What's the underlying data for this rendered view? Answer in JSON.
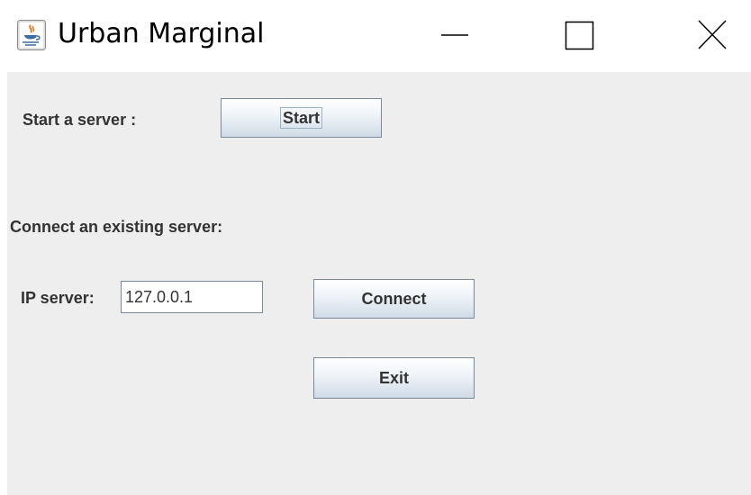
{
  "window": {
    "title": "Urban Marginal",
    "app_icon": "java-cup-icon",
    "controls": {
      "minimize_icon": "minimize-icon",
      "maximize_icon": "maximize-icon",
      "close_icon": "close-icon"
    }
  },
  "start_section": {
    "label": "Start a server :",
    "start_button_label": "Start"
  },
  "connect_section": {
    "heading": "Connect an existing server:",
    "ip_label": "IP server:",
    "ip_value": "127.0.0.1",
    "connect_button_label": "Connect"
  },
  "exit_button_label": "Exit",
  "colors": {
    "panel_background": "#eeeeee",
    "text": "#333333",
    "button_border": "#7a8a99"
  }
}
